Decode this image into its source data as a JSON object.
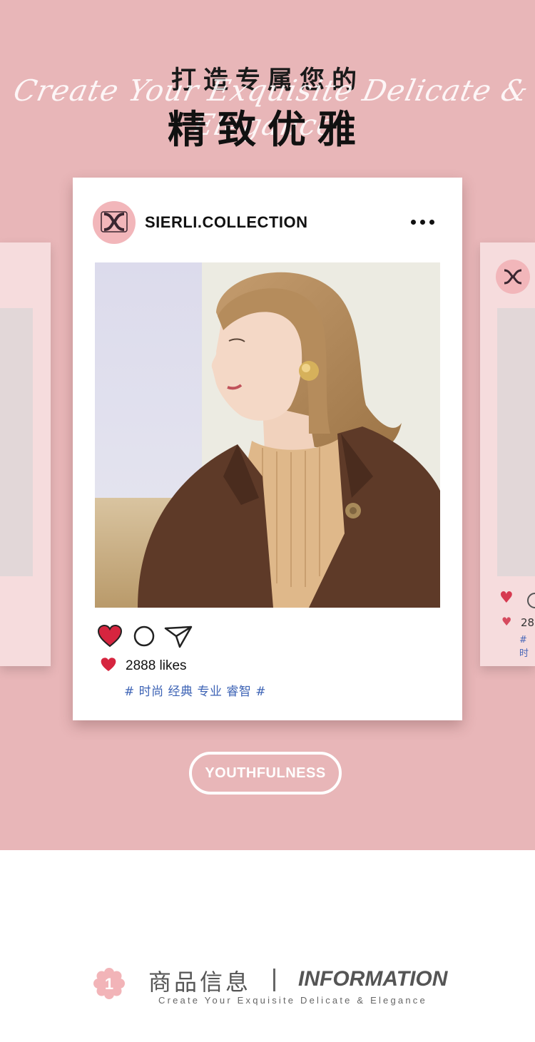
{
  "header": {
    "title_small": "打造专属您的",
    "script_text": "Create Your Exquisite Delicate & Elegance",
    "title_big": "精致优雅"
  },
  "post": {
    "account_name": "SIERLI.COLLECTION",
    "likes_text": "2888 likes",
    "hashtags": "# 时尚 经典 专业 睿智 #"
  },
  "side_post": {
    "likes_partial": "28",
    "hashtags_partial": "# 时"
  },
  "button": {
    "label": "YOUTHFULNESS"
  },
  "section": {
    "number": "1",
    "title_cn": "商品信息",
    "title_en": "INFORMATION",
    "subtitle": "Create Your Exquisite Delicate & Elegance"
  },
  "colors": {
    "background_pink": "#e8b6b8",
    "side_card": "#f6dcdd",
    "avatar": "#f2b6ba",
    "heart_red": "#d6253f",
    "hashtag_blue": "#3d63b5"
  },
  "icons": [
    "logo-icon",
    "more-icon",
    "heart-icon",
    "comment-icon",
    "share-icon",
    "flower-icon"
  ]
}
